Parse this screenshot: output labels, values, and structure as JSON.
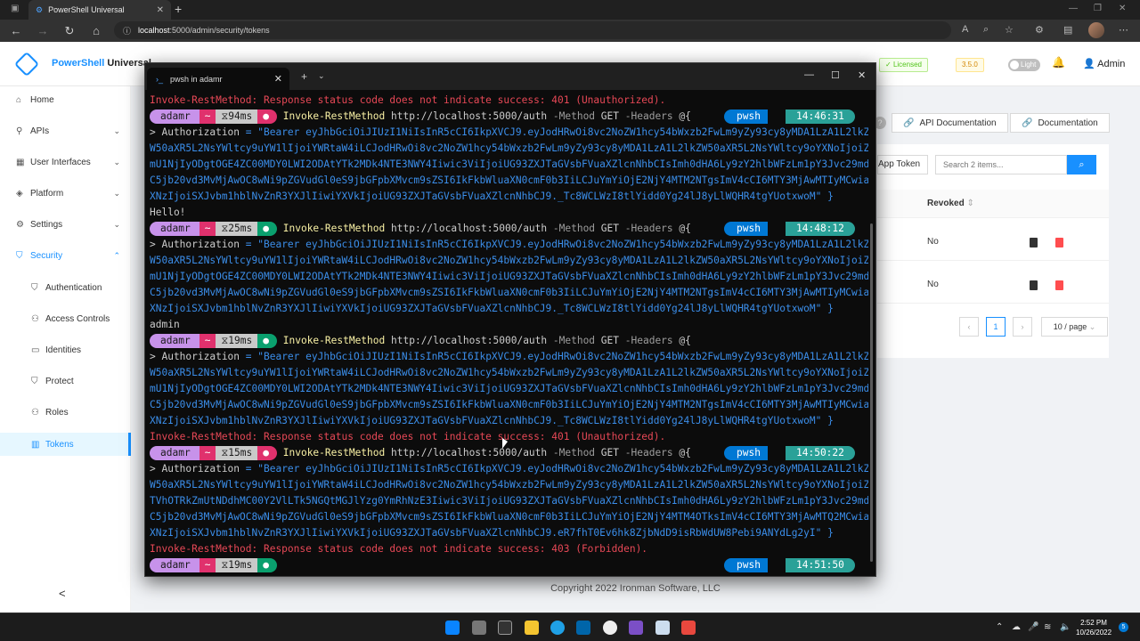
{
  "browser": {
    "tab_title": "PowerShell Universal",
    "url_host": "localhost",
    "url_rest": ":5000/admin/security/tokens"
  },
  "header": {
    "brand": "PowerShell",
    "brand_suffix": "Universal",
    "licensed": "Licensed",
    "version": "3.5.0",
    "theme_toggle": "Light",
    "user": "Admin"
  },
  "sidebar": {
    "items": [
      {
        "label": "Home",
        "icon": "home-icon"
      },
      {
        "label": "APIs",
        "icon": "api-icon"
      },
      {
        "label": "User Interfaces",
        "icon": "dashboard-icon"
      },
      {
        "label": "Platform",
        "icon": "platform-icon"
      },
      {
        "label": "Settings",
        "icon": "settings-icon"
      },
      {
        "label": "Security",
        "icon": "shield-icon"
      }
    ],
    "security_sub": [
      {
        "label": "Authentication"
      },
      {
        "label": "Access Controls"
      },
      {
        "label": "Identities"
      },
      {
        "label": "Protect"
      },
      {
        "label": "Roles"
      },
      {
        "label": "Tokens"
      }
    ]
  },
  "content": {
    "api_docs": "API Documentation",
    "docs": "Documentation",
    "app_token": "App Token",
    "search_placeholder": "Search 2 items...",
    "col_revoked": "Revoked",
    "rows": [
      {
        "revoked": "No"
      },
      {
        "revoked": "No"
      }
    ],
    "page_current": "1",
    "page_size": "10 / page",
    "footer": "Copyright 2022 Ironman Software, LLC"
  },
  "terminal": {
    "tab_title": "pwsh in adamr",
    "user": "adamr",
    "path": "~",
    "shell": "pwsh",
    "lines": {
      "l0": "Invoke-RestMethod: Response status code does not indicate success: 401 (Unauthorized).",
      "p1_time": "94ms",
      "p1_clock": "14:46:31",
      "cmd": "Invoke-RestMethod",
      "url": "http://localhost:5000/auth",
      "method_flag": "-Method",
      "method_val": "GET",
      "headers_flag": "-Headers",
      "headers_open": "@{",
      "auth_key": "> Authorization",
      "tokA1": " = \"Bearer eyJhbGciOiJIUzI1NiIsInR5cCI6IkpXVCJ9.eyJodHRwOi8vc2NoZW1hcy54bWxzb2FwLm9yZy93cy8yMDA1LzA1L2lkZ",
      "tokA2": "W50aXR5L2NsYWltcy9uYW1lIjoiYWRtaW4iLCJodHRwOi8vc2NoZW1hcy54bWxzb2FwLm9yZy93cy8yMDA1LzA1L2lkZW50aXR5L2NsYWltcy9oYXNoIjoiZ",
      "tokA3": "mU1NjIyODgtOGE4ZC00MDY0LWI2ODAtYTk2MDk4NTE3NWY4Iiwic3ViIjoiUG93ZXJTaGVsbFVuaXZlcnNhbCIsImh0dHA6Ly9zY2hlbWFzLm1pY3Jvc29md",
      "tokA4": "C5jb20vd3MvMjAwOC8wNi9pZGVudGl0eS9jbGFpbXMvcm9sZSI6IkFkbWluaXN0cmF0b3IiLCJuYmYiOjE2NjY4MTM2NTgsImV4cCI6MTY3MjAwMTIyMCwia",
      "tokA5": "XNzIjoiSXJvbm1hblNvZnR3YXJlIiwiYXVkIjoiUG93ZXJTaGVsbFVuaXZlcnNhbCJ9._Tc8WCLWzI8tlYidd0Yg24lJ8yLlWQHR4tgYUotxwoM\" }",
      "hello": "Hello!",
      "p2_time": "25ms",
      "p2_clock": "14:48:12",
      "admin": "admin",
      "p3_time": "19ms",
      "headers_open2": "@{",
      "err2": "Invoke-RestMethod: Response status code does not indicate success: 401 (Unauthorized).",
      "p4_time": "15ms",
      "p4_clock": "14:50:22",
      "tokB3": "TVhOTRkZmUtNDdhMC00Y2VlLTk5NGQtMGJlYzg0YmRhNzE3Iiwic3ViIjoiUG93ZXJTaGVsbFVuaXZlcnNhbCIsImh0dHA6Ly9zY2hlbWFzLm1pY3Jvc29md",
      "tokB4": "C5jb20vd3MvMjAwOC8wNi9pZGVudGl0eS9jbGFpbXMvcm9sZSI6IkFkbWluaXN0cmF0b3IiLCJuYmYiOjE2NjY4MTM4OTksImV4cCI6MTY3MjAwMTQ2MCwia",
      "tokB5": "XNzIjoiSXJvbm1hblNvZnR3YXJlIiwiYXVkIjoiUG93ZXJTaGVsbFVuaXZlcnNhbCJ9.eR7fhT0Ev6hk8ZjbNdD9isRbWdUW8Pebi9ANYdLg2yI\" }",
      "err3": "Invoke-RestMethod: Response status code does not indicate success: 403 (Forbidden).",
      "p5_time": "19ms",
      "p5_clock": "14:51:50"
    }
  },
  "taskbar": {
    "time": "2:52 PM",
    "date": "10/26/2022",
    "badge": "5"
  }
}
